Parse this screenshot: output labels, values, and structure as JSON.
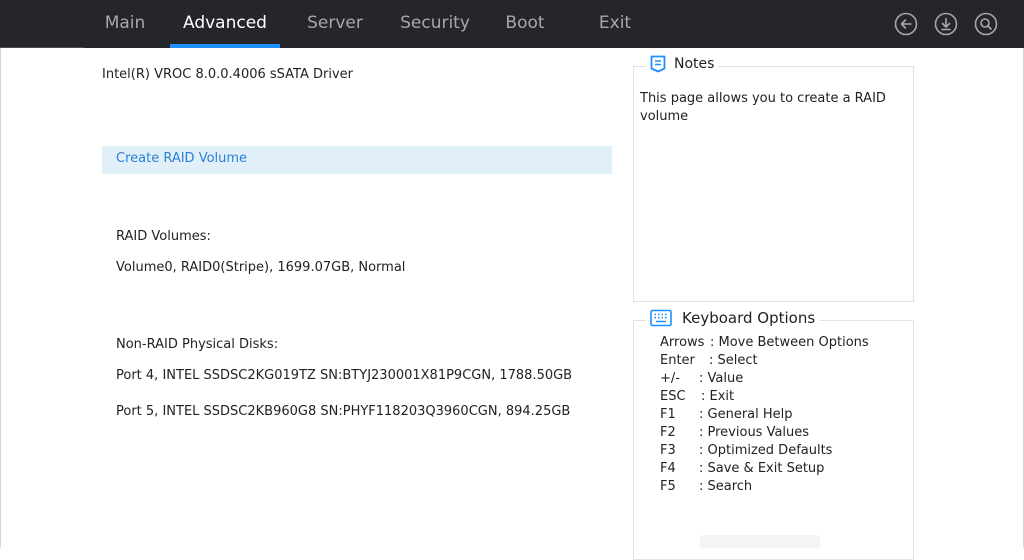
{
  "nav": {
    "tabs": [
      {
        "label": "Main"
      },
      {
        "label": "Advanced"
      },
      {
        "label": "Server"
      },
      {
        "label": "Security"
      },
      {
        "label": "Boot"
      },
      {
        "label": "Exit"
      }
    ],
    "active_tab": "Advanced",
    "icons": [
      "back-icon",
      "download-icon",
      "search-icon"
    ]
  },
  "main": {
    "driver_title": "Intel(R) VROC 8.0.0.4006 sSATA Driver",
    "create_raid_label": "Create RAID Volume",
    "raid_volumes_header": "RAID Volumes:",
    "raid_volumes": [
      "Volume0, RAID0(Stripe), 1699.07GB, Normal"
    ],
    "non_raid_header": "Non-RAID Physical Disks:",
    "non_raid_disks": [
      "Port 4, INTEL SSDSC2KG019TZ SN:BTYJ230001X81P9CGN, 1788.50GB",
      "Port 5, INTEL SSDSC2KB960G8 SN:PHYF118203Q3960CGN, 894.25GB"
    ]
  },
  "notes": {
    "title": "Notes",
    "text": "This page allows you to create a RAID volume"
  },
  "keyboard": {
    "title": "Keyboard Options",
    "options": [
      {
        "key": "Arrows",
        "desc": ": Move Between Options"
      },
      {
        "key": "Enter",
        "desc": ": Select"
      },
      {
        "key": "+/-",
        "desc": ": Value"
      },
      {
        "key": "ESC",
        "desc": ": Exit"
      },
      {
        "key": "F1",
        "desc": ": General Help"
      },
      {
        "key": "F2",
        "desc": ": Previous Values"
      },
      {
        "key": "F3",
        "desc": ": Optimized Defaults"
      },
      {
        "key": "F4",
        "desc": ": Save & Exit Setup"
      },
      {
        "key": "F5",
        "desc": ": Search"
      }
    ]
  },
  "colors": {
    "topbar": "#24262c",
    "accent": "#1e8fff",
    "selected_row": "#e1eff9",
    "link_text": "#2c7fd6",
    "icon_blue": "#1e8fff"
  }
}
